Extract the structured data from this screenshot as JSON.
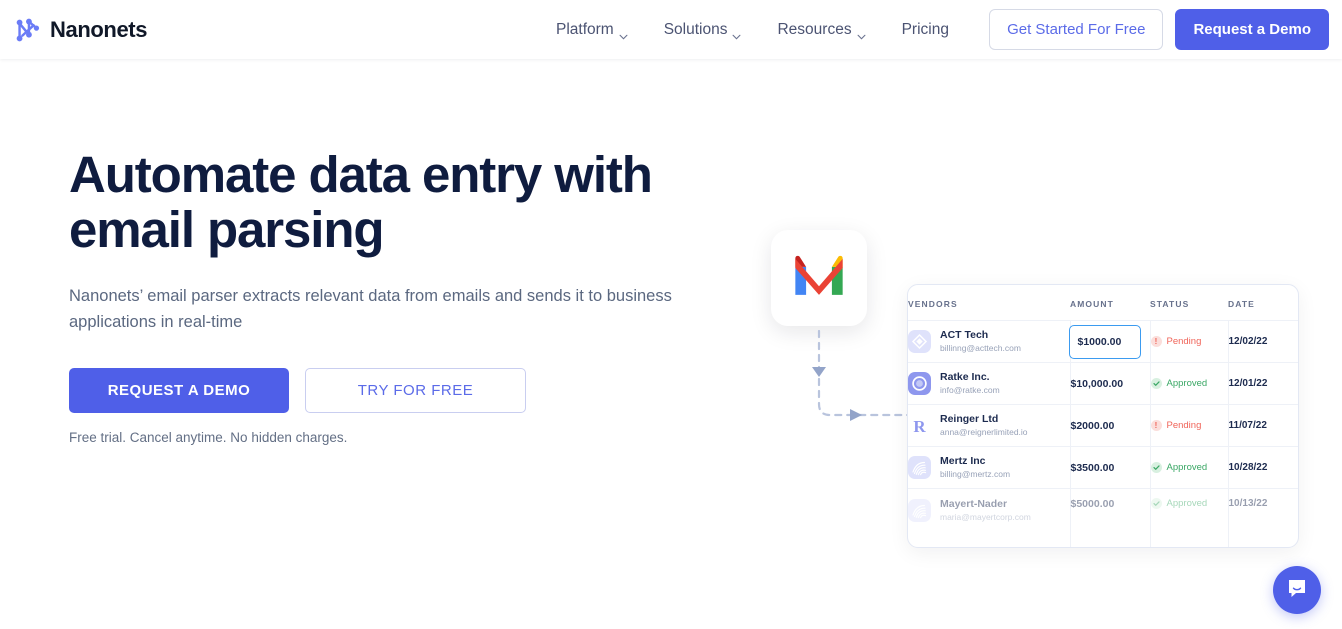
{
  "brand": {
    "name": "Nanonets",
    "logo_icon": "nanonets-network-logo"
  },
  "nav": {
    "items": [
      {
        "label": "Platform",
        "has_dropdown": true
      },
      {
        "label": "Solutions",
        "has_dropdown": true
      },
      {
        "label": "Resources",
        "has_dropdown": true
      },
      {
        "label": "Pricing",
        "has_dropdown": false
      }
    ],
    "get_started_label": "Get Started For Free",
    "request_demo_label": "Request a Demo"
  },
  "hero": {
    "title_line1": "Automate data entry with",
    "title_line2": "email parsing",
    "subtitle": "Nanonets’ email parser extracts relevant data from emails and sends it to business applications in real-time",
    "cta_primary": "REQUEST A DEMO",
    "cta_secondary": "TRY FOR FREE",
    "note": "Free trial. Cancel anytime. No hidden charges."
  },
  "illustration": {
    "mail_icon": "gmail-icon",
    "connector_icon": "dashed-flow-arrow"
  },
  "table": {
    "columns": [
      "VENDORS",
      "AMOUNT",
      "STATUS",
      "DATE"
    ],
    "rows": [
      {
        "vendor": "ACT Tech",
        "email": "billinng@acttech.com",
        "amount": "$1000.00",
        "status": "Pending",
        "date": "12/02/22",
        "avatar_icon": "act-tech-diamond-avatar",
        "active": true,
        "faded": false
      },
      {
        "vendor": "Ratke Inc.",
        "email": "info@ratke.com",
        "amount": "$10,000.00",
        "status": "Approved",
        "date": "12/01/22",
        "avatar_icon": "ratke-ring-avatar",
        "active": false,
        "faded": false
      },
      {
        "vendor": "Reinger Ltd",
        "email": "anna@reignerlimited.io",
        "amount": "$2000.00",
        "status": "Pending",
        "date": "11/07/22",
        "avatar_icon": "reinger-letter-r-avatar",
        "active": false,
        "faded": false
      },
      {
        "vendor": "Mertz Inc",
        "email": "billing@mertz.com",
        "amount": "$3500.00",
        "status": "Approved",
        "date": "10/28/22",
        "avatar_icon": "mertz-fingerprint-avatar",
        "active": false,
        "faded": false
      },
      {
        "vendor": "Mayert-Nader",
        "email": "maria@mayertcorp.com",
        "amount": "$5000.00",
        "status": "Approved",
        "date": "10/13/22",
        "avatar_icon": "mayert-fingerprint-avatar",
        "active": false,
        "faded": true
      }
    ]
  },
  "chat": {
    "icon": "intercom-chat-bubble-icon"
  },
  "colors": {
    "accent": "#4f5fe8",
    "heading": "#0f1c3f",
    "body_text": "#5b6880",
    "pending": "#f0655a",
    "approved": "#3aa765",
    "active_border": "#3b9bf0"
  }
}
